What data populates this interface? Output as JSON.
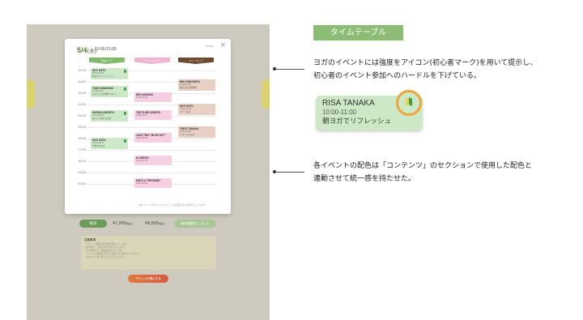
{
  "mock": {
    "modal": {
      "date": "5/4",
      "weekday": "(水)",
      "time_range": "10:00-21:00",
      "close": "close",
      "x": "×",
      "columns": [
        "芝生エリア",
        "ステージエリア",
        "ツリーエリア"
      ],
      "hours": [
        "10:00",
        "11:00",
        "12:00",
        "13:00",
        "14:00",
        "15:00",
        "16:00",
        "17:00",
        "18:00",
        "19:00",
        "20:00"
      ],
      "events": [
        {
          "name": "AKO SATO",
          "time": "10:00-10:45",
          "body": "朝ヨガでリフレッシュ"
        },
        {
          "name": "YUMI KAWASAKI",
          "time": "11:00-11:45",
          "body": "ヨガで心と身体をリセット"
        },
        {
          "name": "HARUKA MORITA",
          "time": "13:30-14:30",
          "body": "ゆったり流れるヨガ"
        },
        {
          "name": "AKO SATO",
          "time": "15:30-16:30",
          "body": "夕暮れのヨガ"
        },
        {
          "name": "MIO HAYASHI",
          "time": "12:00-12:45",
          "body": "ステージライブ"
        },
        {
          "name": "THE SUNFLOWERS",
          "time": "13:30-14:10",
          "body": "ライブ"
        },
        {
          "name": "JAZZ TRIO \"BLUE SKY\"",
          "time": "15:00-15:40",
          "body": "ジャズライブ"
        },
        {
          "name": "DJ KENTA",
          "time": "17:00-17:45",
          "body": "DJタイム"
        },
        {
          "name": "MAYU & THE BAND",
          "time": "19:00-19:45",
          "body": "ライブ"
        },
        {
          "name": "MIKI KINOSHITA",
          "time": "11:00-11:45",
          "body": "森のヨガで深呼吸"
        },
        {
          "name": "AKO SATO",
          "time": "13:00-13:45",
          "body": "ツリーヨガ"
        },
        {
          "name": "TOKO TANAKA",
          "time": "15:00-15:45",
          "body": "リラックスヨガ"
        }
      ],
      "note": "※各イベントのタイムスケジュールは変更となる場合がございます。"
    },
    "sale_button": "販売",
    "price1": "¥7,000",
    "price2": "¥9,500",
    "tax": "(税込)",
    "sold_button": "販売期間終了しました",
    "notes_title": "注意事項",
    "notes_lines": [
      "・チケットの販売状況は随時更新いたします。",
      "・雨天決行。荒天の場合は中止となります。",
      "・お子様連れのご来場も歓迎いたします。",
      "・イベントの内容は予告なく変更となる場合がございます。",
      "・ヨガマット等の貸し出しはございません。"
    ],
    "buy_button": "チケットを購入する"
  },
  "annotations": {
    "tag": "タイムテーブル",
    "text1_line1": "ヨガのイベントには強度をアイコン(初心者マーク)を用いて提示し、",
    "text1_line2": "初心者のイベント参加へのハードルを下げている。",
    "card": {
      "name": "RISA TANAKA",
      "time": "10:00-11:00",
      "desc": "朝ヨガでリフレッシュ",
      "icon": "beginner-mark-icon"
    },
    "text2_line1": "各イベントの配色は「コンテンツ」のセクションで使用した配色と",
    "text2_line2": "連動させて統一感を持たせた。"
  },
  "colors": {
    "accent_green": "#8dbd74",
    "card_green": "#cce8c6",
    "ring_orange": "#eea43a",
    "col_green": "#7fb96a",
    "col_pink": "#efb3d2",
    "col_brown": "#6b4a2e"
  }
}
